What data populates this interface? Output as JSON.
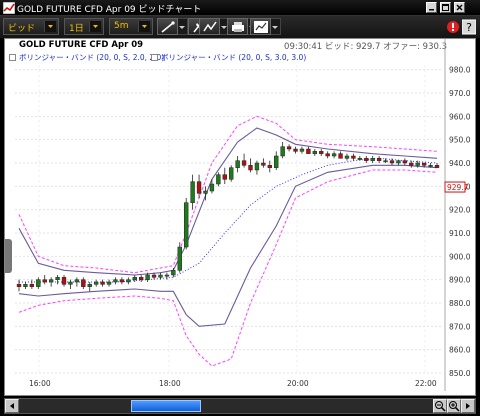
{
  "window": {
    "title": "GOLD FUTURE CFD Apr 09 ビッドチャート",
    "icons": [
      "chart-app-icon",
      "minimize-icon",
      "maximize-icon",
      "close-icon"
    ]
  },
  "toolbar": {
    "price_type": "ビッド",
    "period": "1日",
    "interval": "5m",
    "tools": [
      "line-draw-icon",
      "pin-icon",
      "indicator-icon",
      "print-icon",
      "chart-settings-icon",
      "alert-icon",
      "help-icon"
    ]
  },
  "chart_header": {
    "title": "GOLD FUTURE CFD Apr 09",
    "time": "09:30:41",
    "bid_label": "ビッド",
    "bid_value": "929.7",
    "offer_label": "オファー",
    "offer_value": "930.3"
  },
  "legend": [
    {
      "label": "ボリンジャー・バンド (20, 0, S, 2.0, 2.0)",
      "color": "#1a2ec8"
    },
    {
      "label": "ボリンジャー・バンド (20, 0, S, 3.0, 3.0)",
      "color": "#1a2ec8"
    }
  ],
  "price_axis": {
    "ticks": [
      "980.0",
      "970.0",
      "960.0",
      "950.0",
      "940.0",
      "930.0",
      "920.0",
      "910.0",
      "900.0",
      "890.0",
      "880.0",
      "870.0",
      "860.0",
      "850.0"
    ],
    "current_price": "929.7"
  },
  "time_axis": {
    "ticks": [
      "16:00",
      "18:00",
      "20:00",
      "22:00"
    ]
  },
  "colors": {
    "up_candle": "#1f7a1f",
    "down_candle": "#b01010",
    "band2": "#6a5a9a",
    "band3": "#ff40ff",
    "mid": "#3030ff",
    "price_tag": "#d01010"
  },
  "chart_data": {
    "type": "candlestick",
    "instrument": "GOLD FUTURE CFD Apr 09",
    "ylim": [
      850,
      982
    ],
    "x_range": [
      "15:30",
      "22:30"
    ],
    "candles": [
      {
        "o": 888,
        "h": 890,
        "l": 885,
        "c": 887
      },
      {
        "o": 887,
        "h": 889,
        "l": 886,
        "c": 888
      },
      {
        "o": 888,
        "h": 890,
        "l": 886,
        "c": 887
      },
      {
        "o": 887,
        "h": 891,
        "l": 886,
        "c": 890
      },
      {
        "o": 890,
        "h": 892,
        "l": 888,
        "c": 889
      },
      {
        "o": 889,
        "h": 891,
        "l": 887,
        "c": 890
      },
      {
        "o": 890,
        "h": 892,
        "l": 888,
        "c": 891
      },
      {
        "o": 891,
        "h": 892,
        "l": 887,
        "c": 888
      },
      {
        "o": 888,
        "h": 890,
        "l": 886,
        "c": 889
      },
      {
        "o": 889,
        "h": 891,
        "l": 887,
        "c": 890
      },
      {
        "o": 890,
        "h": 891,
        "l": 886,
        "c": 887
      },
      {
        "o": 887,
        "h": 889,
        "l": 885,
        "c": 888
      },
      {
        "o": 888,
        "h": 890,
        "l": 887,
        "c": 889
      },
      {
        "o": 889,
        "h": 890,
        "l": 887,
        "c": 888
      },
      {
        "o": 888,
        "h": 890,
        "l": 887,
        "c": 889
      },
      {
        "o": 889,
        "h": 891,
        "l": 888,
        "c": 890
      },
      {
        "o": 890,
        "h": 891,
        "l": 888,
        "c": 889
      },
      {
        "o": 889,
        "h": 891,
        "l": 888,
        "c": 890
      },
      {
        "o": 890,
        "h": 892,
        "l": 889,
        "c": 891
      },
      {
        "o": 891,
        "h": 892,
        "l": 889,
        "c": 890
      },
      {
        "o": 890,
        "h": 893,
        "l": 889,
        "c": 892
      },
      {
        "o": 892,
        "h": 893,
        "l": 890,
        "c": 891
      },
      {
        "o": 891,
        "h": 893,
        "l": 890,
        "c": 892
      },
      {
        "o": 892,
        "h": 893,
        "l": 890,
        "c": 892
      },
      {
        "o": 892,
        "h": 895,
        "l": 891,
        "c": 894
      },
      {
        "o": 894,
        "h": 906,
        "l": 893,
        "c": 904
      },
      {
        "o": 904,
        "h": 925,
        "l": 903,
        "c": 923
      },
      {
        "o": 923,
        "h": 935,
        "l": 920,
        "c": 932
      },
      {
        "o": 932,
        "h": 935,
        "l": 925,
        "c": 927
      },
      {
        "o": 927,
        "h": 930,
        "l": 924,
        "c": 928
      },
      {
        "o": 928,
        "h": 933,
        "l": 927,
        "c": 931
      },
      {
        "o": 931,
        "h": 936,
        "l": 930,
        "c": 935
      },
      {
        "o": 935,
        "h": 938,
        "l": 931,
        "c": 933
      },
      {
        "o": 933,
        "h": 939,
        "l": 932,
        "c": 938
      },
      {
        "o": 938,
        "h": 943,
        "l": 936,
        "c": 941
      },
      {
        "o": 941,
        "h": 944,
        "l": 938,
        "c": 939
      },
      {
        "o": 939,
        "h": 942,
        "l": 936,
        "c": 937
      },
      {
        "o": 937,
        "h": 941,
        "l": 935,
        "c": 940
      },
      {
        "o": 940,
        "h": 942,
        "l": 938,
        "c": 939
      },
      {
        "o": 939,
        "h": 941,
        "l": 936,
        "c": 938
      },
      {
        "o": 938,
        "h": 945,
        "l": 937,
        "c": 943
      },
      {
        "o": 943,
        "h": 949,
        "l": 942,
        "c": 947
      },
      {
        "o": 947,
        "h": 948,
        "l": 945,
        "c": 946
      },
      {
        "o": 946,
        "h": 947,
        "l": 944,
        "c": 945
      },
      {
        "o": 945,
        "h": 947,
        "l": 944,
        "c": 946
      },
      {
        "o": 946,
        "h": 947,
        "l": 944,
        "c": 944
      },
      {
        "o": 944,
        "h": 946,
        "l": 943,
        "c": 945
      },
      {
        "o": 945,
        "h": 946,
        "l": 943,
        "c": 944
      },
      {
        "o": 944,
        "h": 945,
        "l": 942,
        "c": 943
      },
      {
        "o": 943,
        "h": 945,
        "l": 942,
        "c": 944
      },
      {
        "o": 944,
        "h": 945,
        "l": 942,
        "c": 942
      },
      {
        "o": 942,
        "h": 944,
        "l": 941,
        "c": 943
      },
      {
        "o": 943,
        "h": 944,
        "l": 941,
        "c": 942
      },
      {
        "o": 942,
        "h": 943,
        "l": 941,
        "c": 942
      },
      {
        "o": 942,
        "h": 943,
        "l": 940,
        "c": 941
      },
      {
        "o": 941,
        "h": 943,
        "l": 940,
        "c": 942
      },
      {
        "o": 942,
        "h": 943,
        "l": 940,
        "c": 941
      },
      {
        "o": 941,
        "h": 942,
        "l": 940,
        "c": 941
      },
      {
        "o": 941,
        "h": 942,
        "l": 939,
        "c": 940
      },
      {
        "o": 940,
        "h": 941,
        "l": 939,
        "c": 941
      },
      {
        "o": 941,
        "h": 942,
        "l": 939,
        "c": 940
      },
      {
        "o": 940,
        "h": 941,
        "l": 938,
        "c": 939
      },
      {
        "o": 939,
        "h": 941,
        "l": 938,
        "c": 940
      },
      {
        "o": 940,
        "h": 940,
        "l": 938,
        "c": 939
      },
      {
        "o": 939,
        "h": 940,
        "l": 938,
        "c": 939
      },
      {
        "o": 939,
        "h": 940,
        "l": 938,
        "c": 938
      }
    ],
    "bands": {
      "upper3": [
        [
          0,
          918
        ],
        [
          3,
          900
        ],
        [
          7,
          896
        ],
        [
          12,
          895
        ],
        [
          18,
          893
        ],
        [
          22,
          895
        ],
        [
          24,
          896
        ],
        [
          26,
          910
        ],
        [
          30,
          940
        ],
        [
          34,
          956
        ],
        [
          37,
          960
        ],
        [
          40,
          957
        ],
        [
          43,
          950
        ],
        [
          48,
          948
        ],
        [
          55,
          947
        ],
        [
          60,
          946
        ],
        [
          65,
          945
        ]
      ],
      "upper2": [
        [
          0,
          912
        ],
        [
          3,
          897
        ],
        [
          7,
          894
        ],
        [
          12,
          893
        ],
        [
          18,
          892
        ],
        [
          22,
          893
        ],
        [
          24,
          894
        ],
        [
          26,
          905
        ],
        [
          30,
          933
        ],
        [
          34,
          949
        ],
        [
          37,
          955
        ],
        [
          40,
          952
        ],
        [
          43,
          948
        ],
        [
          48,
          946
        ],
        [
          55,
          944
        ],
        [
          60,
          943
        ],
        [
          65,
          942
        ]
      ],
      "mid": [
        [
          0,
          889
        ],
        [
          5,
          889
        ],
        [
          10,
          889
        ],
        [
          15,
          889
        ],
        [
          20,
          890
        ],
        [
          24,
          891
        ],
        [
          28,
          897
        ],
        [
          32,
          910
        ],
        [
          36,
          922
        ],
        [
          40,
          930
        ],
        [
          44,
          935
        ],
        [
          48,
          939
        ],
        [
          52,
          941
        ],
        [
          56,
          942
        ],
        [
          60,
          941
        ],
        [
          65,
          940
        ]
      ],
      "lower2": [
        [
          0,
          884
        ],
        [
          3,
          883
        ],
        [
          7,
          884
        ],
        [
          12,
          885
        ],
        [
          18,
          886
        ],
        [
          22,
          885
        ],
        [
          24,
          885
        ],
        [
          26,
          875
        ],
        [
          28,
          870
        ],
        [
          32,
          871
        ],
        [
          36,
          895
        ],
        [
          40,
          913
        ],
        [
          43,
          930
        ],
        [
          48,
          936
        ],
        [
          55,
          939
        ],
        [
          60,
          939
        ],
        [
          65,
          938
        ]
      ],
      "lower3": [
        [
          0,
          876
        ],
        [
          3,
          879
        ],
        [
          7,
          881
        ],
        [
          12,
          882
        ],
        [
          18,
          883
        ],
        [
          22,
          882
        ],
        [
          24,
          881
        ],
        [
          26,
          866
        ],
        [
          28,
          858
        ],
        [
          30,
          853
        ],
        [
          33,
          856
        ],
        [
          36,
          880
        ],
        [
          40,
          905
        ],
        [
          43,
          925
        ],
        [
          48,
          932
        ],
        [
          55,
          937
        ],
        [
          60,
          937
        ],
        [
          65,
          936
        ]
      ]
    }
  },
  "scrollbar": {
    "thumb_start": 0.27,
    "thumb_end": 0.44
  }
}
